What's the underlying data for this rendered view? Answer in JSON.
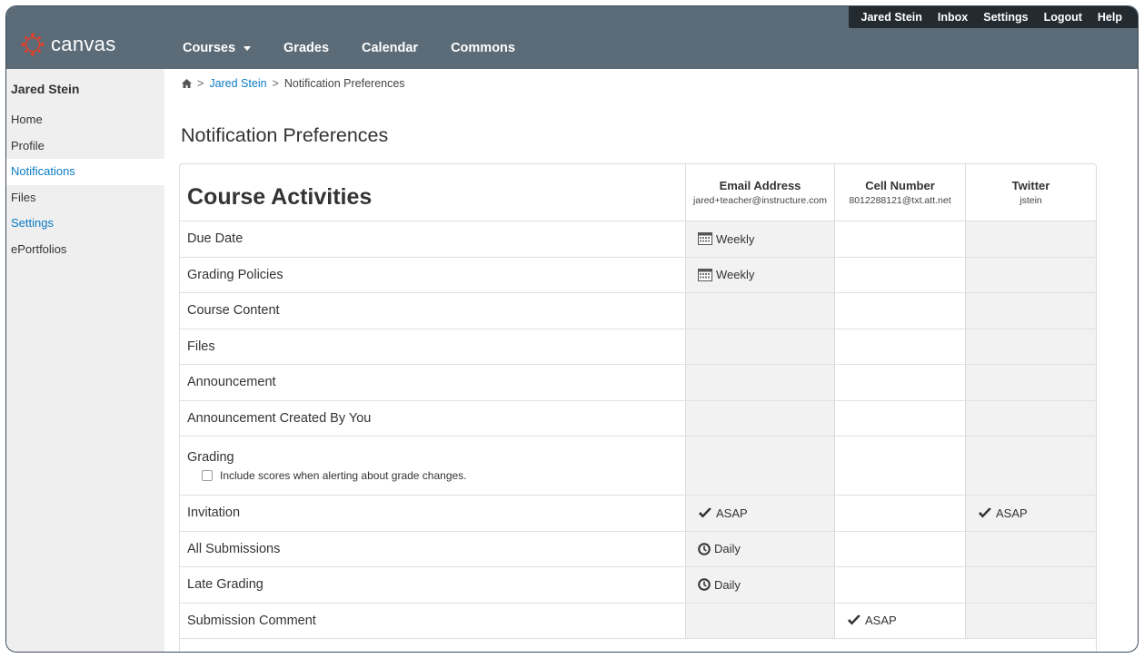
{
  "app": {
    "logo_text": "canvas",
    "brand_color": "#5b6b77",
    "accent_color": "#0a7bc4"
  },
  "utility_nav": [
    "Jared Stein",
    "Inbox",
    "Settings",
    "Logout",
    "Help"
  ],
  "main_nav": [
    {
      "label": "Courses"
    },
    {
      "label": "Grades"
    },
    {
      "label": "Calendar"
    },
    {
      "label": "Commons"
    }
  ],
  "left_nav": {
    "user": "Jared Stein",
    "items": [
      "Home",
      "Profile",
      "Notifications",
      "Files",
      "Settings",
      "ePortfolios"
    ]
  },
  "breadcrumb": {
    "user": "Jared Stein",
    "current": "Notification Preferences"
  },
  "page_title": "Notification Preferences",
  "table": {
    "section": "Course Activities",
    "columns": [
      {
        "name": "Email Address",
        "value": "jared+teacher@instructure.com"
      },
      {
        "name": "Cell Number",
        "value": "8012288121@txt.att.net"
      },
      {
        "name": "Twitter",
        "value": "jstein"
      }
    ],
    "rows": [
      {
        "label": "Due Date",
        "email": "Weekly",
        "cell": "",
        "twitter": ""
      },
      {
        "label": "Grading Policies",
        "email": "Weekly",
        "cell": "",
        "twitter": ""
      },
      {
        "label": "Course Content",
        "email": "",
        "cell": "",
        "twitter": ""
      },
      {
        "label": "Files",
        "email": "",
        "cell": "",
        "twitter": ""
      },
      {
        "label": "Announcement",
        "email": "",
        "cell": "",
        "twitter": ""
      },
      {
        "label": "Announcement Created By You",
        "email": "",
        "cell": "",
        "twitter": ""
      },
      {
        "label": "Grading",
        "option": "Include scores when alerting about grade changes.",
        "email": "",
        "cell": "",
        "twitter": ""
      },
      {
        "label": "Invitation",
        "email": "ASAP",
        "cell": "",
        "twitter": "ASAP"
      },
      {
        "label": "All Submissions",
        "email": "Daily",
        "cell": "",
        "twitter": ""
      },
      {
        "label": "Late Grading",
        "email": "Daily",
        "cell": "",
        "twitter": ""
      },
      {
        "label": "Submission Comment",
        "email": "",
        "cell": "ASAP",
        "twitter": ""
      }
    ]
  }
}
